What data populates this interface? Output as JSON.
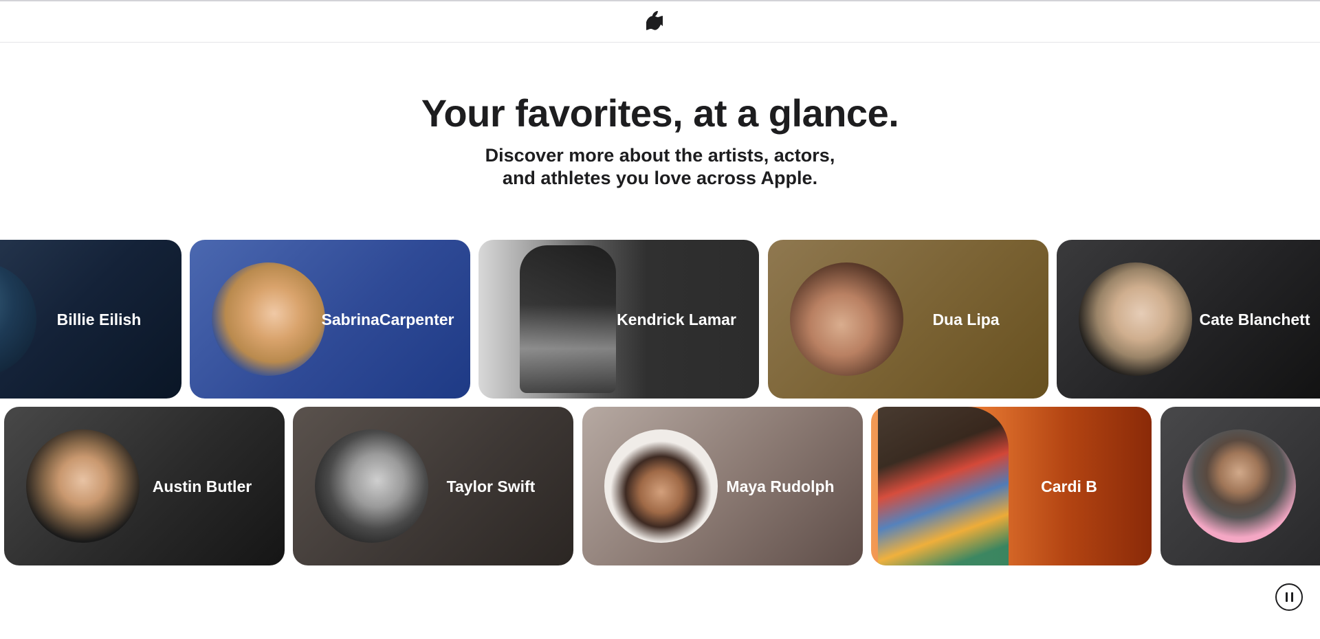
{
  "nav": {
    "logo_icon": "apple-logo-icon"
  },
  "hero": {
    "title": "Your favorites, at a glance.",
    "subtitle_line1": "Discover more about the artists, actors,",
    "subtitle_line2": "and athletes you love across Apple."
  },
  "row1": [
    {
      "name": "Billie Eilish",
      "bg": "#14243a"
    },
    {
      "name_line1": "Sabrina",
      "name_line2": "Carpenter",
      "bg": "#2f4a96"
    },
    {
      "name": "Kendrick Lamar",
      "bg": "#2c2c2c"
    },
    {
      "name": "Dua Lipa",
      "bg": "#7a6233"
    },
    {
      "name": "Cate Blanchett",
      "bg": "#1c1c1e"
    }
  ],
  "row2": [
    {
      "name": "Austin Butler",
      "bg": "#1f1f1f"
    },
    {
      "name": "Taylor Swift",
      "bg": "#3e3835"
    },
    {
      "name": "Maya Rudolph",
      "bg": "#7d6c66"
    },
    {
      "name": "Cardi B",
      "bg": "#b34412"
    },
    {
      "name": "",
      "bg": "#2e2e30"
    }
  ],
  "controls": {
    "pause_icon": "pause-icon"
  }
}
